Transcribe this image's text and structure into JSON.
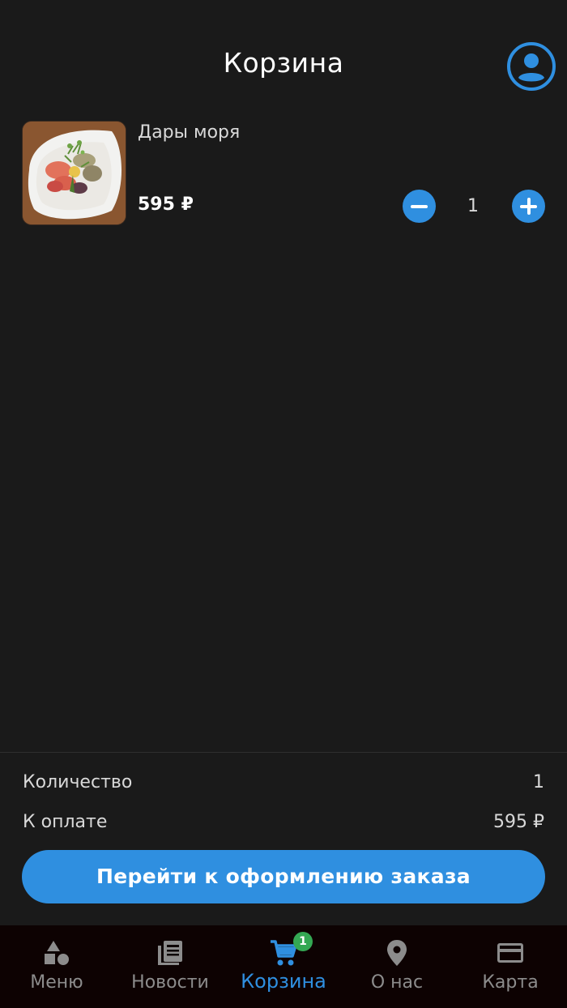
{
  "header": {
    "title": "Корзина",
    "profile_icon": "account-circle-icon"
  },
  "cart": {
    "items": [
      {
        "name": "Дары моря",
        "price": "595 ₽",
        "quantity": "1",
        "image": "seafood-dish-photo"
      }
    ]
  },
  "summary": {
    "quantity_label": "Количество",
    "quantity_value": "1",
    "total_label": "К оплате",
    "total_value": "595 ₽",
    "checkout_label": "Перейти к оформлению заказа"
  },
  "nav": {
    "items": [
      {
        "label": "Меню",
        "icon": "shapes-icon"
      },
      {
        "label": "Новости",
        "icon": "newspaper-icon"
      },
      {
        "label": "Корзина",
        "icon": "cart-icon",
        "active": true,
        "badge": "1"
      },
      {
        "label": "О нас",
        "icon": "location-pin-icon"
      },
      {
        "label": "Карта",
        "icon": "credit-card-icon"
      }
    ]
  },
  "colors": {
    "background": "#1a1a1a",
    "accent": "#2f8fe0",
    "nav_background": "#0d0202",
    "badge": "#34a853",
    "inactive": "#8c8c8c"
  }
}
